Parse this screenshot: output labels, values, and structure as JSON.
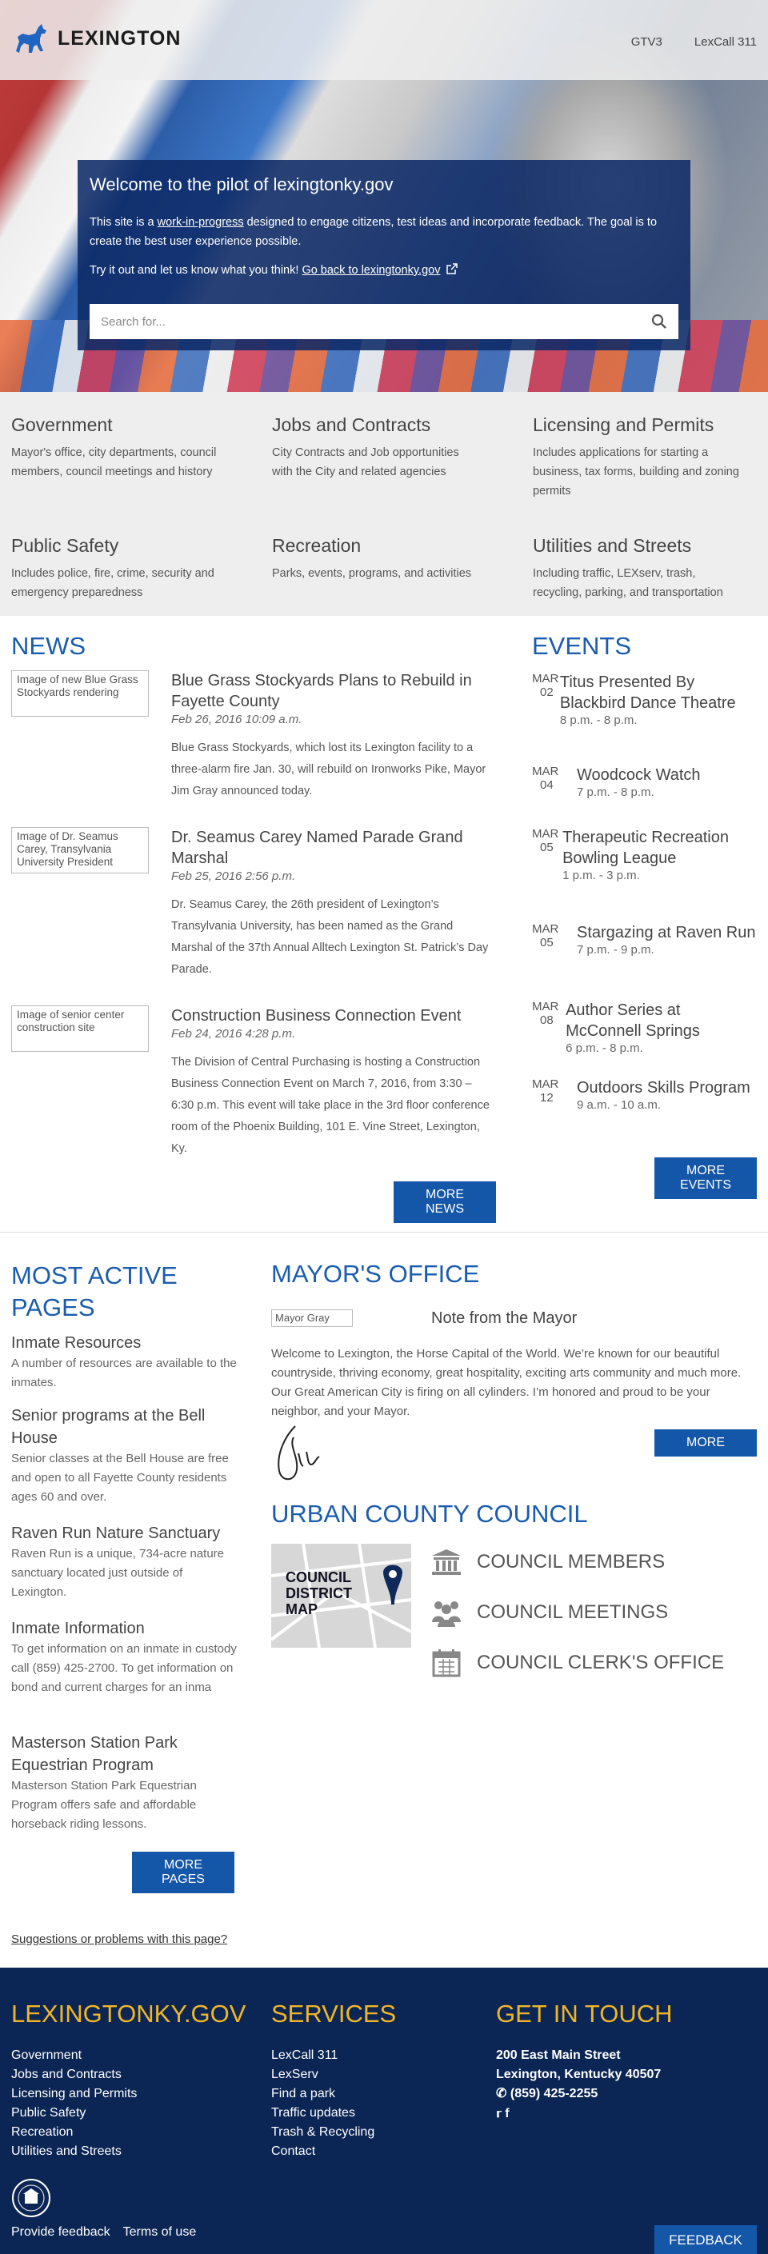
{
  "header": {
    "logo_text": "LEXINGTON",
    "links": [
      "GTV3",
      "LexCall 311"
    ]
  },
  "welcome": {
    "title": "Welcome to the pilot of lexingtonky.gov",
    "p1_pre": "This site is a ",
    "p1_link": "work-in-progress",
    "p1_post": " designed to engage citizens, test ideas and incorporate feedback. The goal is to create the best user experience possible.",
    "p2_pre": "Try it out and let us know what you think! ",
    "p2_link": "Go back to lexingtonky.gov",
    "search_placeholder": "Search for..."
  },
  "categories": [
    {
      "title": "Government",
      "desc": "Mayor's office, city departments, council members, council meetings and history"
    },
    {
      "title": "Jobs and Contracts",
      "desc": "City Contracts and Job opportunities with the City and related agencies"
    },
    {
      "title": "Licensing and Permits",
      "desc": "Includes applications for starting a business, tax forms, building and zoning permits"
    },
    {
      "title": "Public Safety",
      "desc": "Includes police, fire, crime, security and emergency preparedness"
    },
    {
      "title": "Recreation",
      "desc": "Parks, events, programs, and activities"
    },
    {
      "title": "Utilities and Streets",
      "desc": "Including traffic, LEXserv, trash, recycling, parking, and transportation"
    }
  ],
  "news": {
    "title": "NEWS",
    "more_label": "MORE NEWS",
    "items": [
      {
        "img_alt": "Image of new Blue Grass Stockyards rendering",
        "title": "Blue Grass Stockyards Plans to Rebuild in Fayette County",
        "date": "Feb 26, 2016 10:09 a.m.",
        "body": "Blue Grass Stockyards, which lost its Lexington facility to a three-alarm fire Jan. 30, will rebuild on Ironworks Pike, Mayor Jim Gray announced today."
      },
      {
        "img_alt": "Image of Dr. Seamus Carey, Transylvania University President",
        "title": "Dr. Seamus Carey Named Parade Grand Marshal",
        "date": "Feb 25, 2016 2:56 p.m.",
        "body": "Dr. Seamus Carey, the 26th president of Lexington’s Transylvania University, has been named as the Grand Marshal of the 37th Annual Alltech Lexington St. Patrick’s Day Parade."
      },
      {
        "img_alt": "Image of senior center construction site",
        "title": "Construction Business Connection Event",
        "date": "Feb 24, 2016 4:28 p.m.",
        "body": "The Division of Central Purchasing is hosting a Construction Business Connection Event on March 7, 2016, from 3:30 – 6:30 p.m. This event will take place in the 3rd floor conference room of the Phoenix Building, 101 E. Vine Street, Lexington, Ky."
      }
    ]
  },
  "events": {
    "title": "EVENTS",
    "more_label": "MORE EVENTS",
    "items": [
      {
        "month": "MAR",
        "day": "02",
        "title": "Titus Presented By Blackbird Dance Theatre",
        "time": "8 p.m. - 8 p.m."
      },
      {
        "month": "MAR",
        "day": "04",
        "title": "Woodcock Watch",
        "time": "7 p.m. - 8 p.m."
      },
      {
        "month": "MAR",
        "day": "05",
        "title": "Therapeutic Recreation Bowling League",
        "time": "1 p.m. - 3 p.m."
      },
      {
        "month": "MAR",
        "day": "05",
        "title": "Stargazing at Raven Run",
        "time": "7 p.m. - 9 p.m."
      },
      {
        "month": "MAR",
        "day": "08",
        "title": "Author Series at McConnell Springs",
        "time": "6 p.m. - 8 p.m."
      },
      {
        "month": "MAR",
        "day": "12",
        "title": "Outdoors Skills Program",
        "time": "9 a.m. - 10 a.m."
      }
    ]
  },
  "most_active": {
    "title": "MOST ACTIVE PAGES",
    "more_label": "MORE PAGES",
    "items": [
      {
        "title": "Inmate Resources",
        "desc": "A number of resources are available to the inmates."
      },
      {
        "title": "Senior programs at the Bell House",
        "desc": "Senior classes at the Bell House are free and open to all Fayette County residents ages 60 and over."
      },
      {
        "title": "Raven Run Nature Sanctuary",
        "desc": "Raven Run is a unique, 734-acre nature sanctuary located just outside of Lexington."
      },
      {
        "title": "Inmate Information",
        "desc": "To get information on an inmate in custody call (859) 425-2700. To get information on bond and current charges for an inma"
      },
      {
        "title": "Masterson Station Park Equestrian Program",
        "desc": "Masterson Station Park Equestrian Program offers safe and affordable horseback riding lessons."
      }
    ],
    "suggestions": "Suggestions or problems with this page?"
  },
  "mayor": {
    "title": "MAYOR'S OFFICE",
    "img_alt": "Mayor Gray",
    "note_title": "Note from the Mayor",
    "text": "Welcome to Lexington, the Horse Capital of the World. We’re known for our beautiful countryside, thriving economy, great hospitality, exciting arts community and much more. Our Great American City is firing on all cylinders. I’m honored and proud to be your neighbor, and your Mayor.",
    "more_label": "MORE"
  },
  "council": {
    "title": "URBAN COUNTY COUNCIL",
    "map_label_1": "COUNCIL",
    "map_label_2": "DISTRICT",
    "map_label_3": "MAP",
    "links": [
      "COUNCIL MEMBERS",
      "COUNCIL MEETINGS",
      "COUNCIL CLERK'S OFFICE"
    ]
  },
  "footer": {
    "col1_title": "LEXINGTONKY.GOV",
    "col1_links": [
      "Government",
      "Jobs and Contracts",
      "Licensing and Permits",
      "Public Safety",
      "Recreation",
      "Utilities and Streets"
    ],
    "col2_title": "SERVICES",
    "col2_links": [
      "LexCall 311",
      "LexServ",
      "Find a park",
      "Traffic updates",
      "Trash & Recycling",
      "Contact"
    ],
    "col3_title": "GET IN TOUCH",
    "address1": "200 East Main Street",
    "address2": "Lexington, Kentucky 40507",
    "phone": "(859) 425-2255",
    "bottom_links": [
      "Provide feedback",
      "Terms of use"
    ],
    "feedback_label": "FEEDBACK"
  },
  "colors": {
    "accent": "#1a5cad",
    "footer_bg": "#0b2554",
    "footer_title": "#f0b627",
    "button": "#1456a8"
  }
}
